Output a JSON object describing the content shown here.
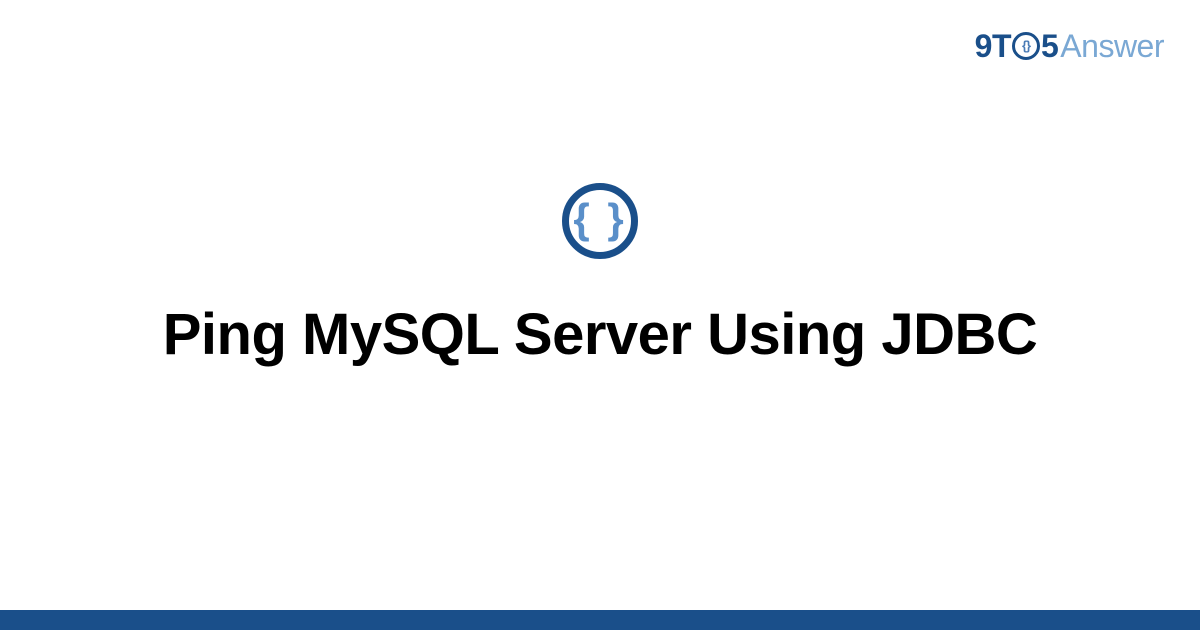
{
  "brand": {
    "nine": "9",
    "t": "T",
    "o_inner": "{}",
    "five": "5",
    "answer": "Answer"
  },
  "icon": {
    "braces": "{ }"
  },
  "title": "Ping MySQL Server Using JDBC",
  "colors": {
    "primary": "#1a4f8a",
    "accent": "#5a8fc9",
    "light_blue": "#7aa8d4"
  }
}
